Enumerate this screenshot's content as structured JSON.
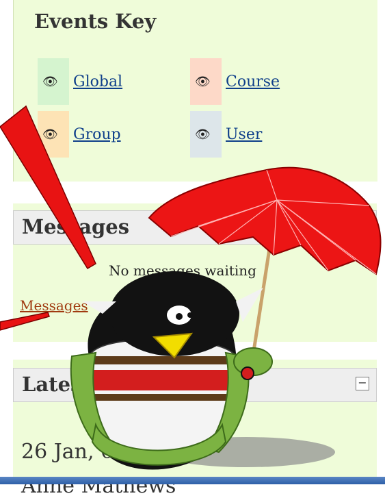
{
  "events_key": {
    "title": "Events Key",
    "items": [
      {
        "label": "Global",
        "color": "#d5f4cf"
      },
      {
        "label": "Course",
        "color": "#fdd9c8"
      },
      {
        "label": "Group",
        "color": "#fde3b5"
      },
      {
        "label": "User",
        "color": "#dde6ea"
      }
    ]
  },
  "messages": {
    "title": "Messages",
    "status": "No messages waiting",
    "link": "Messages",
    "collapse": "−"
  },
  "latest": {
    "title": "Latest News",
    "date": "26 Jan, 08:",
    "next_line": "Anne Mathews"
  },
  "colors": {
    "block_bg": "#effcd9",
    "link": "#0f3f8a",
    "messages_link": "#a03a10",
    "arrow": "#e81313"
  }
}
